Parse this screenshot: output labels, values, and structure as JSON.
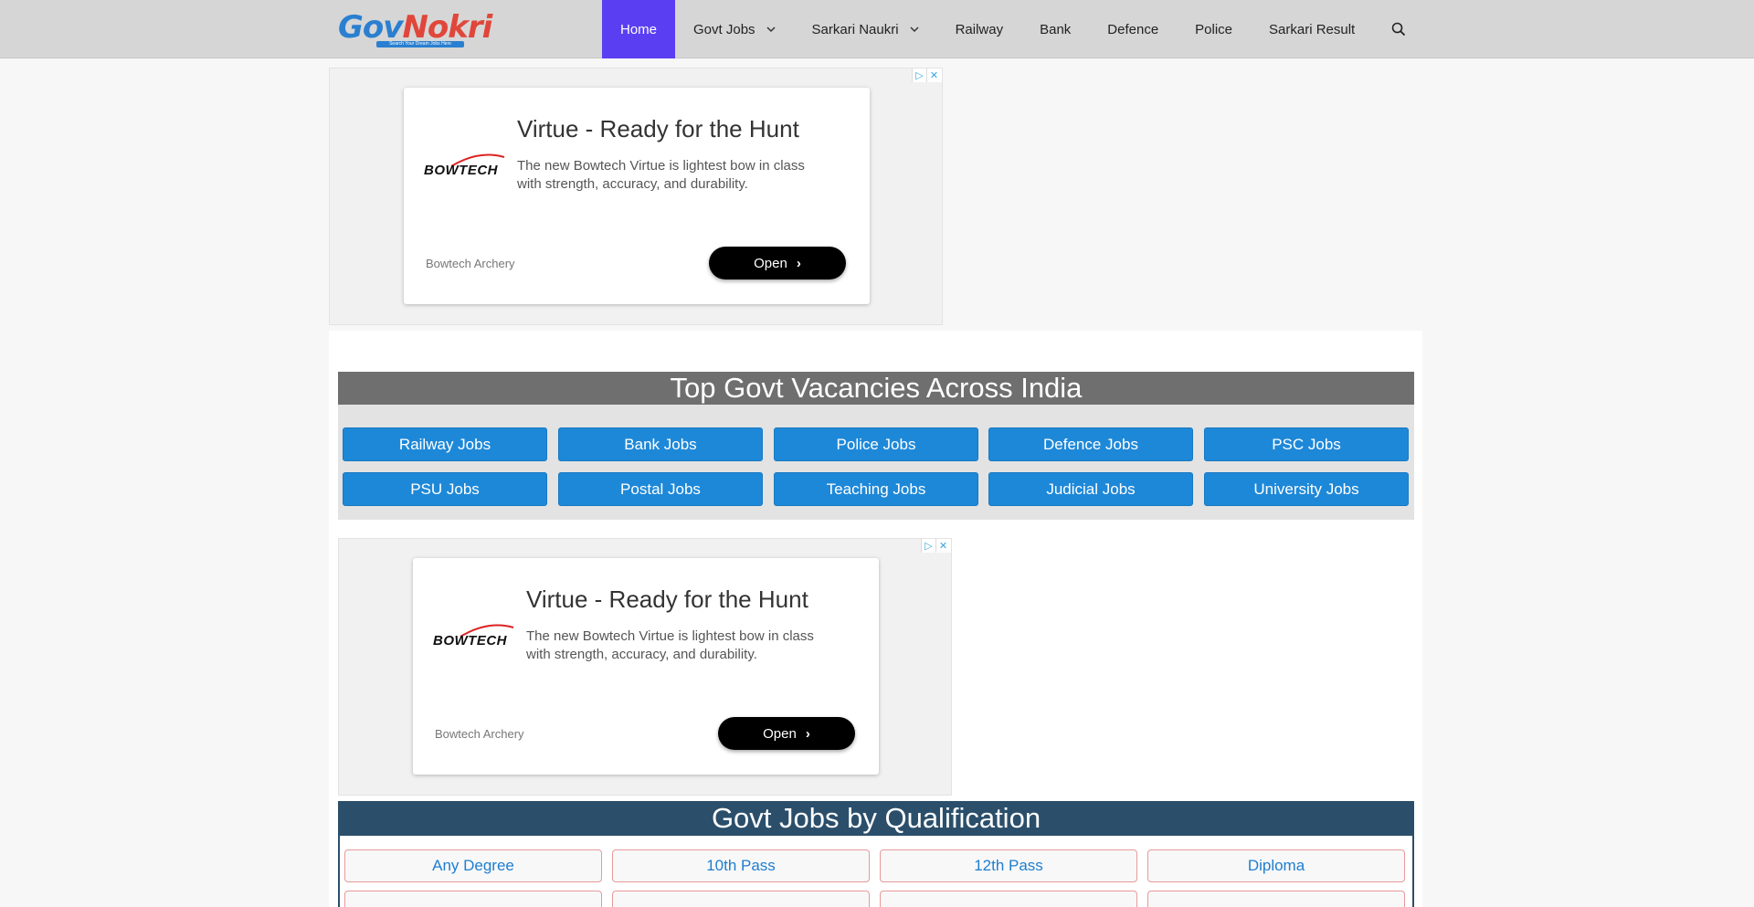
{
  "header": {
    "logo": {
      "text": "GovNokri",
      "tagline": "Search Your Dream Jobs Here"
    },
    "nav": [
      {
        "label": "Home",
        "active": true,
        "dropdown": false
      },
      {
        "label": "Govt Jobs",
        "active": false,
        "dropdown": true
      },
      {
        "label": "Sarkari Naukri",
        "active": false,
        "dropdown": true
      },
      {
        "label": "Railway",
        "active": false,
        "dropdown": false
      },
      {
        "label": "Bank",
        "active": false,
        "dropdown": false
      },
      {
        "label": "Defence",
        "active": false,
        "dropdown": false
      },
      {
        "label": "Police",
        "active": false,
        "dropdown": false
      },
      {
        "label": "Sarkari Result",
        "active": false,
        "dropdown": false
      }
    ],
    "search_icon": "search-icon"
  },
  "ads": [
    {
      "brand": "BOWTECH",
      "title": "Virtue - Ready for the Hunt",
      "description": "The new Bowtech Virtue is lightest bow in class with strength, accuracy, and durability.",
      "advertiser": "Bowtech Archery",
      "cta": "Open"
    },
    {
      "brand": "BOWTECH",
      "title": "Virtue - Ready for the Hunt",
      "description": "The new Bowtech Virtue is lightest bow in class with strength, accuracy, and durability.",
      "advertiser": "Bowtech Archery",
      "cta": "Open"
    }
  ],
  "vacancies": {
    "heading": "Top Govt Vacancies Across India",
    "items": [
      "Railway Jobs",
      "Bank Jobs",
      "Police Jobs",
      "Defence Jobs",
      "PSC Jobs",
      "PSU Jobs",
      "Postal Jobs",
      "Teaching Jobs",
      "Judicial Jobs",
      "University Jobs"
    ]
  },
  "qualification": {
    "heading": "Govt Jobs by Qualification",
    "items": [
      "Any Degree",
      "10th Pass",
      "12th Pass",
      "Diploma"
    ]
  },
  "colors": {
    "nav_active": "#5a3ff2",
    "vacancy_button": "#1e88d8",
    "qualification_header": "#2b4f6b",
    "vacancy_header": "#6f6f6f"
  }
}
